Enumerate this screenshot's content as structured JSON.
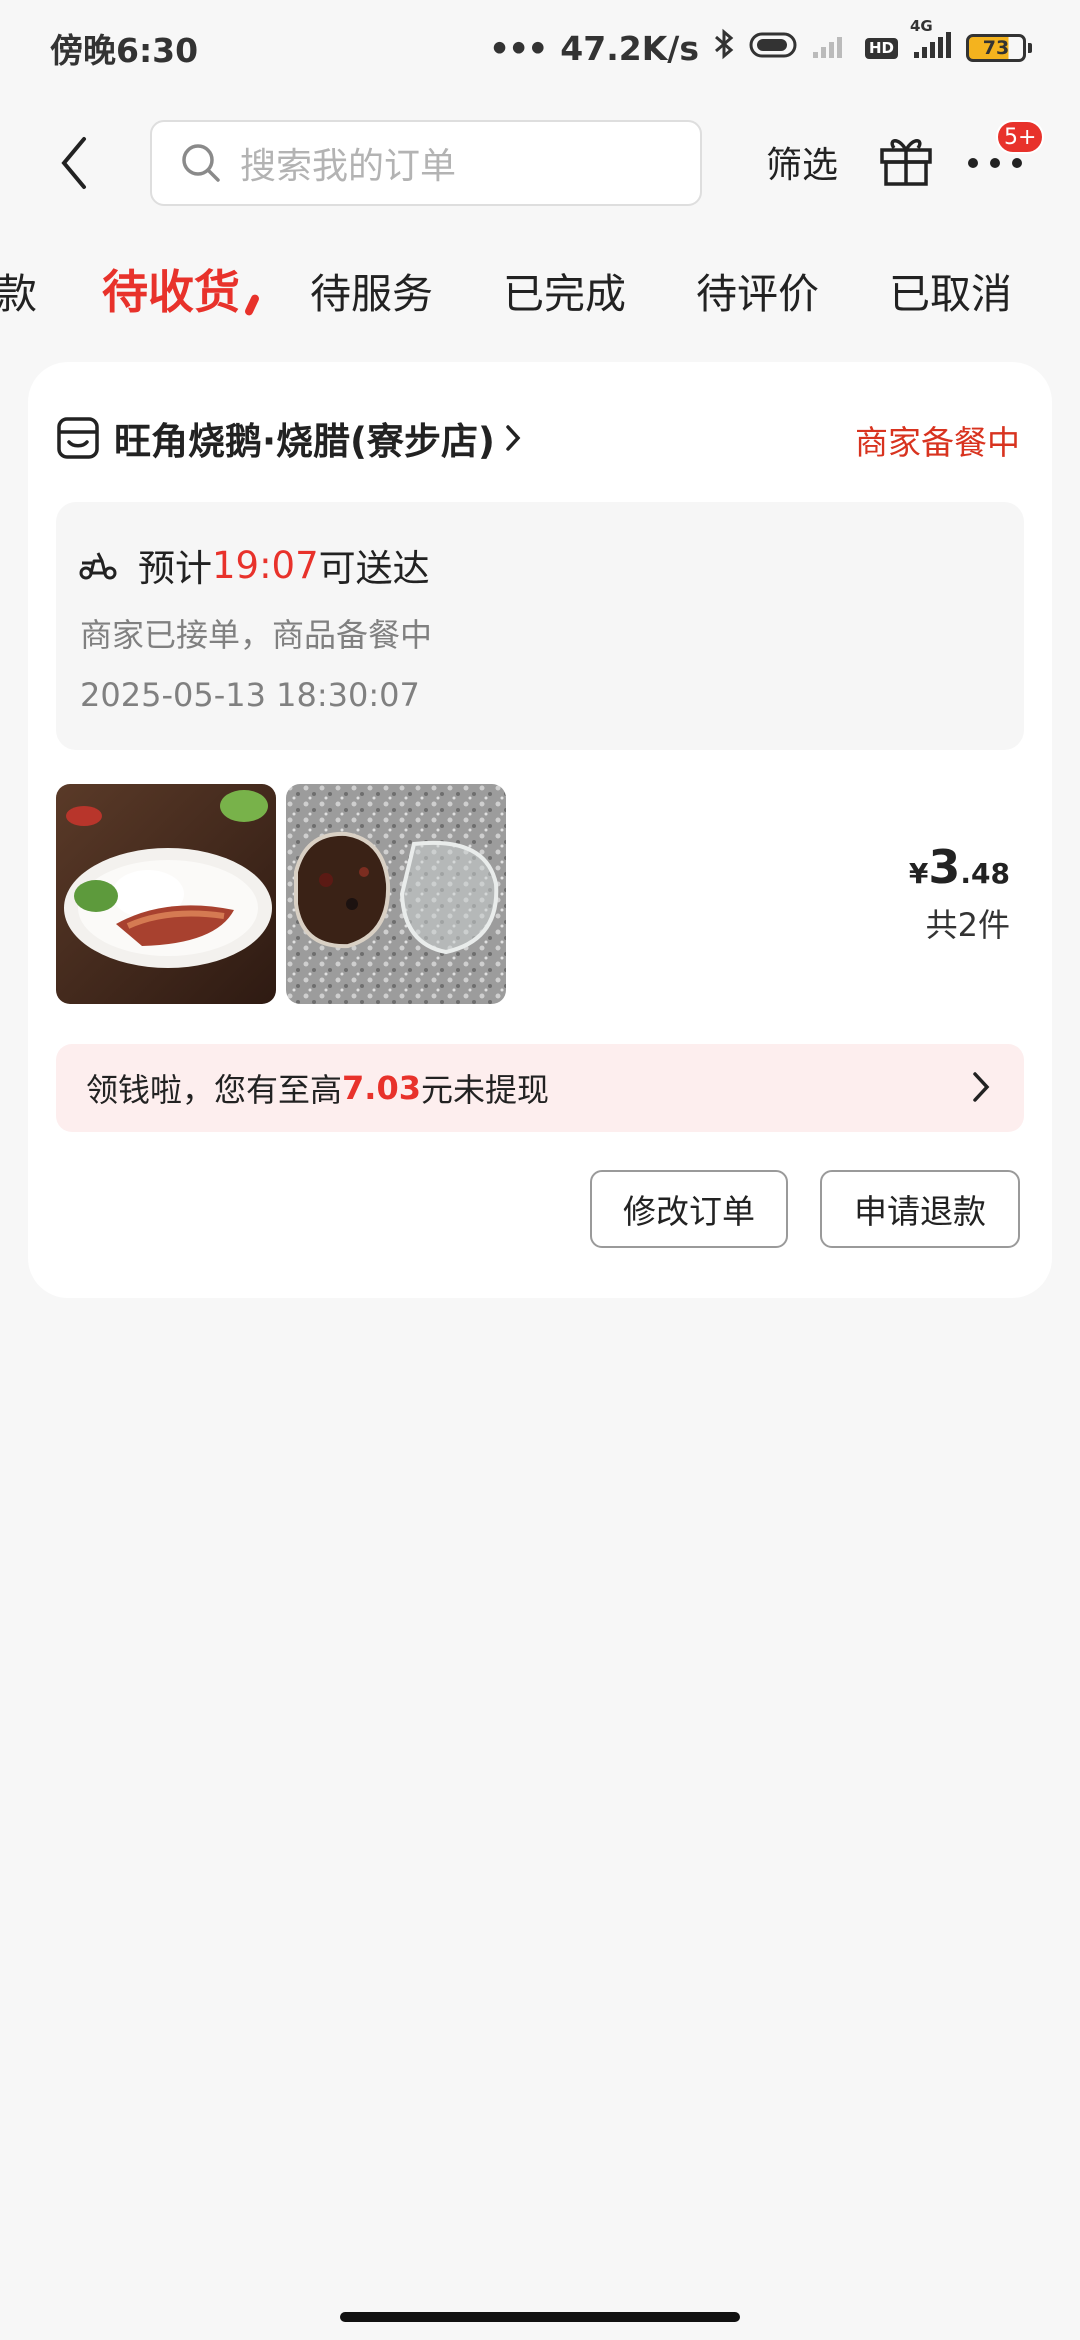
{
  "status_bar": {
    "time": "傍晚6:30",
    "dots": "•••",
    "net_speed": "47.2K/s",
    "hd": "HD",
    "network": "4G",
    "battery": "73"
  },
  "header": {
    "search_placeholder": "搜索我的订单",
    "filter_label": "筛选",
    "more_badge": "5+"
  },
  "tabs": [
    {
      "label": "款"
    },
    {
      "label": "待收货",
      "active": true
    },
    {
      "label": "待服务"
    },
    {
      "label": "已完成"
    },
    {
      "label": "待评价"
    },
    {
      "label": "已取消"
    }
  ],
  "order": {
    "shop_name": "旺角烧鹅·烧腊(寮步店)",
    "status": "商家备餐中",
    "eta_prefix": "预计",
    "eta_time": "19:07",
    "eta_suffix": "可送达",
    "delivery_status": "商家已接单，商品备餐中",
    "order_time": "2025-05-13 18:30:07",
    "price_currency": "¥",
    "price_int": "3",
    "price_dec": ".48",
    "item_count": "共2件",
    "promo_prefix": "领钱啦，您有至高",
    "promo_amount": "7.03",
    "promo_suffix": "元未提现",
    "modify_label": "修改订单",
    "refund_label": "申请退款"
  },
  "colors": {
    "accent": "#e8322b",
    "status_text": "#d8331f",
    "promo_bg": "#fdeeee",
    "page_bg": "#f7f7f7"
  }
}
